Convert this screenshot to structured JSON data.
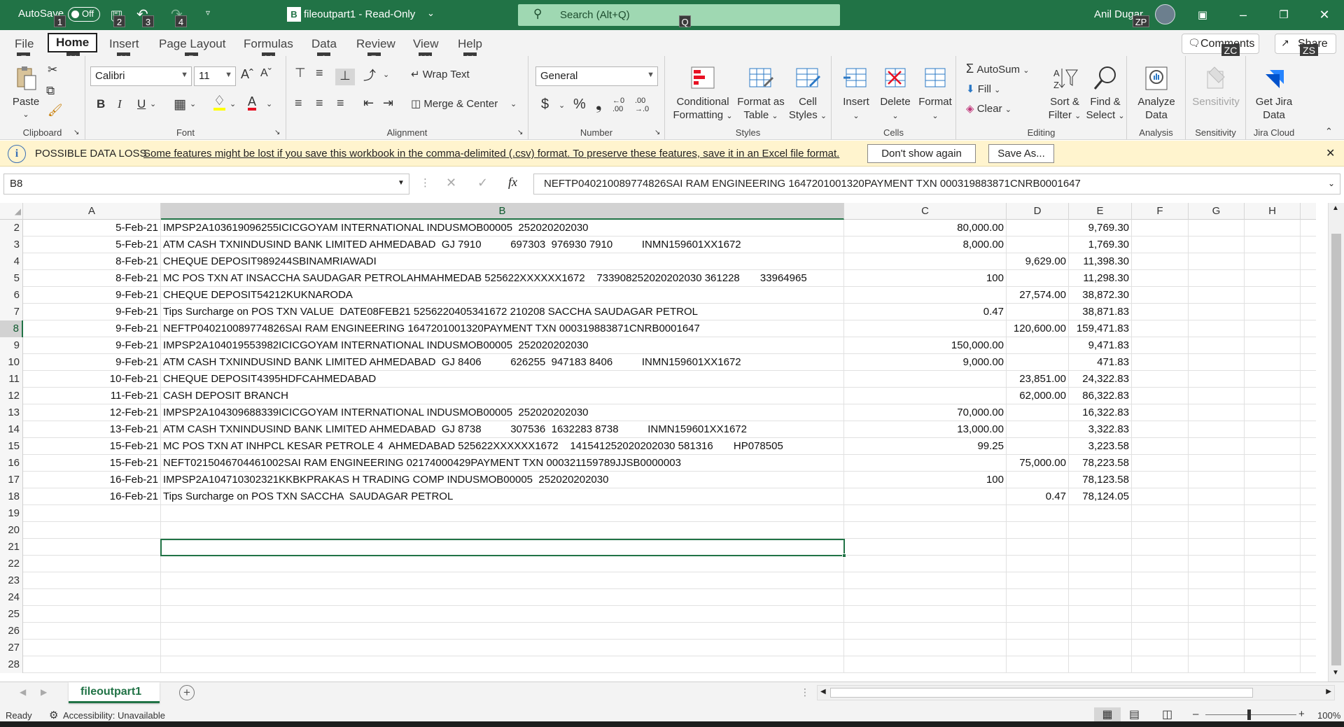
{
  "titlebar": {
    "autosave_label": "AutoSave",
    "autosave_state": "Off",
    "doc_icon_letter": "B",
    "doc_title": "fileoutpart1  -  Read-Only",
    "search_placeholder": "Search (Alt+Q)",
    "user_name": "Anil Dugar",
    "keytips": [
      "1",
      "2",
      "3",
      "4",
      "Q",
      "ZP"
    ],
    "accent_color": "#217346"
  },
  "ribbon": {
    "tabs": [
      "File",
      "Home",
      "Insert",
      "Page Layout",
      "Formulas",
      "Data",
      "Review",
      "View",
      "Help"
    ],
    "tab_keytips": [
      "F",
      "H",
      "N",
      "P",
      "M",
      "A",
      "R",
      "W",
      "Y"
    ],
    "comments_label": "Comments",
    "share_label": "Share",
    "comments_keytip": "ZC",
    "share_keytip": "ZS",
    "clipboard": {
      "paste": "Paste",
      "label": "Clipboard"
    },
    "font": {
      "name": "Calibri",
      "size": "11",
      "label": "Font",
      "bold": "B",
      "italic": "I",
      "underline": "U"
    },
    "alignment": {
      "wrap": "Wrap Text",
      "merge": "Merge & Center",
      "label": "Alignment"
    },
    "number": {
      "format": "General",
      "label": "Number",
      "currency": "$",
      "percent": "%",
      "comma": "❟"
    },
    "styles": {
      "conditional": [
        "Conditional",
        "Formatting"
      ],
      "table": [
        "Format as",
        "Table"
      ],
      "cell": [
        "Cell",
        "Styles"
      ],
      "label": "Styles"
    },
    "cells": {
      "insert": "Insert",
      "delete": "Delete",
      "format": "Format",
      "label": "Cells"
    },
    "editing": {
      "autosum": "AutoSum",
      "fill": "Fill",
      "clear": "Clear",
      "sort": [
        "Sort &",
        "Filter"
      ],
      "find": [
        "Find &",
        "Select"
      ],
      "label": "Editing"
    },
    "analysis": {
      "analyze": [
        "Analyze",
        "Data"
      ],
      "label": "Analysis"
    },
    "sensitivity": {
      "button": "Sensitivity",
      "label": "Sensitivity"
    },
    "jira": {
      "button": [
        "Get Jira",
        "Data"
      ],
      "label": "Jira Cloud"
    }
  },
  "infobar": {
    "title": "POSSIBLE DATA LOSS",
    "message": "Some features might be lost if you save this workbook in the comma-delimited (.csv) format. To preserve these features, save it in an Excel file format.",
    "dont_show": "Don't show again",
    "save_as": "Save As..."
  },
  "formula_bar": {
    "name_box": "B8",
    "fx": "fx",
    "content": "NEFTP040210089774826SAI RAM ENGINEERING 1647201001320PAYMENT TXN 000319883871CNRB0001647"
  },
  "sheet": {
    "columns": [
      "A",
      "B",
      "C",
      "D",
      "E",
      "F",
      "G",
      "H"
    ],
    "selected_cell": "B8",
    "rows": [
      {
        "n": "2",
        "a": "5-Feb-21",
        "b": "IMPSP2A103619096255ICICGOYAM INTERNATIONAL INDUSMOB00005  252020202030",
        "c": "80,000.00",
        "d": "",
        "e": "9,769.30"
      },
      {
        "n": "3",
        "a": "5-Feb-21",
        "b": "ATM CASH TXNINDUSIND BANK LIMITED AHMEDABAD  GJ 7910          697303  976930 7910          INMN159601XX1672",
        "c": "8,000.00",
        "d": "",
        "e": "1,769.30"
      },
      {
        "n": "4",
        "a": "8-Feb-21",
        "b": "CHEQUE DEPOSIT989244SBINAMRIAWADI",
        "c": "",
        "d": "9,629.00",
        "e": "11,398.30"
      },
      {
        "n": "5",
        "a": "8-Feb-21",
        "b": "MC POS TXN AT INSACCHA SAUDAGAR PETROLAHMAHMEDAB 525622XXXXXX1672    733908252020202030 361228       33964965",
        "c": "100",
        "d": "",
        "e": "11,298.30"
      },
      {
        "n": "6",
        "a": "9-Feb-21",
        "b": "CHEQUE DEPOSIT54212KUKNARODA",
        "c": "",
        "d": "27,574.00",
        "e": "38,872.30"
      },
      {
        "n": "7",
        "a": "9-Feb-21",
        "b": "Tips Surcharge on POS TXN VALUE  DATE08FEB21 5256220405341672 210208 SACCHA SAUDAGAR PETROL",
        "c": "0.47",
        "d": "",
        "e": "38,871.83"
      },
      {
        "n": "8",
        "a": "9-Feb-21",
        "b": "NEFTP040210089774826SAI RAM ENGINEERING 1647201001320PAYMENT TXN 000319883871CNRB0001647",
        "c": "",
        "d": "120,600.00",
        "e": "159,471.83"
      },
      {
        "n": "9",
        "a": "9-Feb-21",
        "b": "IMPSP2A104019553982ICICGOYAM INTERNATIONAL INDUSMOB00005  252020202030",
        "c": "150,000.00",
        "d": "",
        "e": "9,471.83"
      },
      {
        "n": "10",
        "a": "9-Feb-21",
        "b": "ATM CASH TXNINDUSIND BANK LIMITED AHMEDABAD  GJ 8406          626255  947183 8406          INMN159601XX1672",
        "c": "9,000.00",
        "d": "",
        "e": "471.83"
      },
      {
        "n": "11",
        "a": "10-Feb-21",
        "b": "CHEQUE DEPOSIT4395HDFCAHMEDABAD",
        "c": "",
        "d": "23,851.00",
        "e": "24,322.83"
      },
      {
        "n": "12",
        "a": "11-Feb-21",
        "b": "CASH DEPOSIT BRANCH",
        "c": "",
        "d": "62,000.00",
        "e": "86,322.83"
      },
      {
        "n": "13",
        "a": "12-Feb-21",
        "b": "IMPSP2A104309688339ICICGOYAM INTERNATIONAL INDUSMOB00005  252020202030",
        "c": "70,000.00",
        "d": "",
        "e": "16,322.83"
      },
      {
        "n": "14",
        "a": "13-Feb-21",
        "b": "ATM CASH TXNINDUSIND BANK LIMITED AHMEDABAD  GJ 8738          307536  1632283 8738          INMN159601XX1672",
        "c": "13,000.00",
        "d": "",
        "e": "3,322.83"
      },
      {
        "n": "15",
        "a": "15-Feb-21",
        "b": "MC POS TXN AT INHPCL KESAR PETROLE 4  AHMEDABAD 525622XXXXXX1672    141541252020202030 581316       HP078505",
        "c": "99.25",
        "d": "",
        "e": "3,223.58"
      },
      {
        "n": "16",
        "a": "15-Feb-21",
        "b": "NEFT0215046704461002SAI RAM ENGINEERING 02174000429PAYMENT TXN 000321159789JJSB0000003",
        "c": "",
        "d": "75,000.00",
        "e": "78,223.58"
      },
      {
        "n": "17",
        "a": "16-Feb-21",
        "b": "IMPSP2A104710302321KKBKPRAKAS H TRADING COMP INDUSMOB00005  252020202030",
        "c": "100",
        "d": "",
        "e": "78,123.58"
      },
      {
        "n": "18",
        "a": "16-Feb-21",
        "b": "Tips Surcharge on POS TXN SACCHA  SAUDAGAR PETROL",
        "c": "",
        "d": "0.47",
        "e": "78,124.05"
      },
      {
        "n": "19",
        "a": "",
        "b": "",
        "c": "",
        "d": "",
        "e": ""
      },
      {
        "n": "20",
        "a": "",
        "b": "",
        "c": "",
        "d": "",
        "e": ""
      },
      {
        "n": "21",
        "a": "",
        "b": "",
        "c": "",
        "d": "",
        "e": ""
      },
      {
        "n": "22",
        "a": "",
        "b": "",
        "c": "",
        "d": "",
        "e": ""
      },
      {
        "n": "23",
        "a": "",
        "b": "",
        "c": "",
        "d": "",
        "e": ""
      },
      {
        "n": "24",
        "a": "",
        "b": "",
        "c": "",
        "d": "",
        "e": ""
      },
      {
        "n": "25",
        "a": "",
        "b": "",
        "c": "",
        "d": "",
        "e": ""
      },
      {
        "n": "26",
        "a": "",
        "b": "",
        "c": "",
        "d": "",
        "e": ""
      },
      {
        "n": "27",
        "a": "",
        "b": "",
        "c": "",
        "d": "",
        "e": ""
      },
      {
        "n": "28",
        "a": "",
        "b": "",
        "c": "",
        "d": "",
        "e": ""
      }
    ]
  },
  "sheet_tabs": {
    "active": "fileoutpart1"
  },
  "status": {
    "ready": "Ready",
    "accessibility": "Accessibility: Unavailable",
    "zoom": "100%"
  }
}
